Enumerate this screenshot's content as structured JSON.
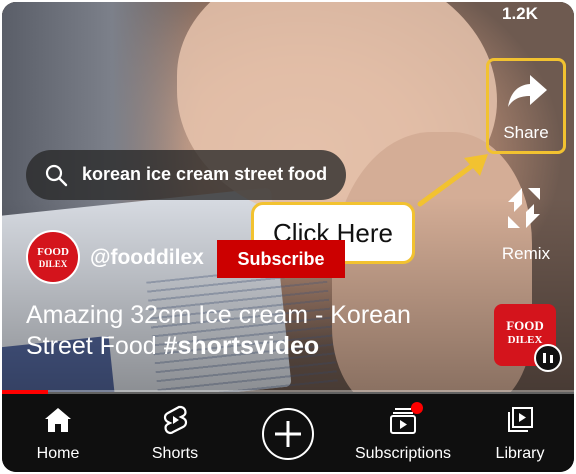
{
  "video": {
    "view_count": "1.2K",
    "search_query": "korean ice cream street food",
    "channel_handle": "@fooddilex",
    "subscribe_label": "Subscribe",
    "title_plain": "Amazing 32cm Ice cream - Korean Street Food ",
    "title_hashtag": "#shortsvideo",
    "avatar_text_line1": "FOOD",
    "avatar_text_line2": "DILEX",
    "progress_fraction": 0.08
  },
  "actions": {
    "share_label": "Share",
    "remix_label": "Remix"
  },
  "tooltip": {
    "text": "Click Here"
  },
  "nav": {
    "items": [
      {
        "label": "Home",
        "icon": "home-icon"
      },
      {
        "label": "Shorts",
        "icon": "shorts-icon"
      },
      {
        "label": "",
        "icon": "create-icon"
      },
      {
        "label": "Subscriptions",
        "icon": "subscriptions-icon"
      },
      {
        "label": "Library",
        "icon": "library-icon"
      }
    ]
  },
  "colors": {
    "highlight": "#f2c230",
    "subscribe_bg": "#cc0000",
    "brand_red": "#d4141c",
    "nav_bg": "#0f0f0f"
  }
}
